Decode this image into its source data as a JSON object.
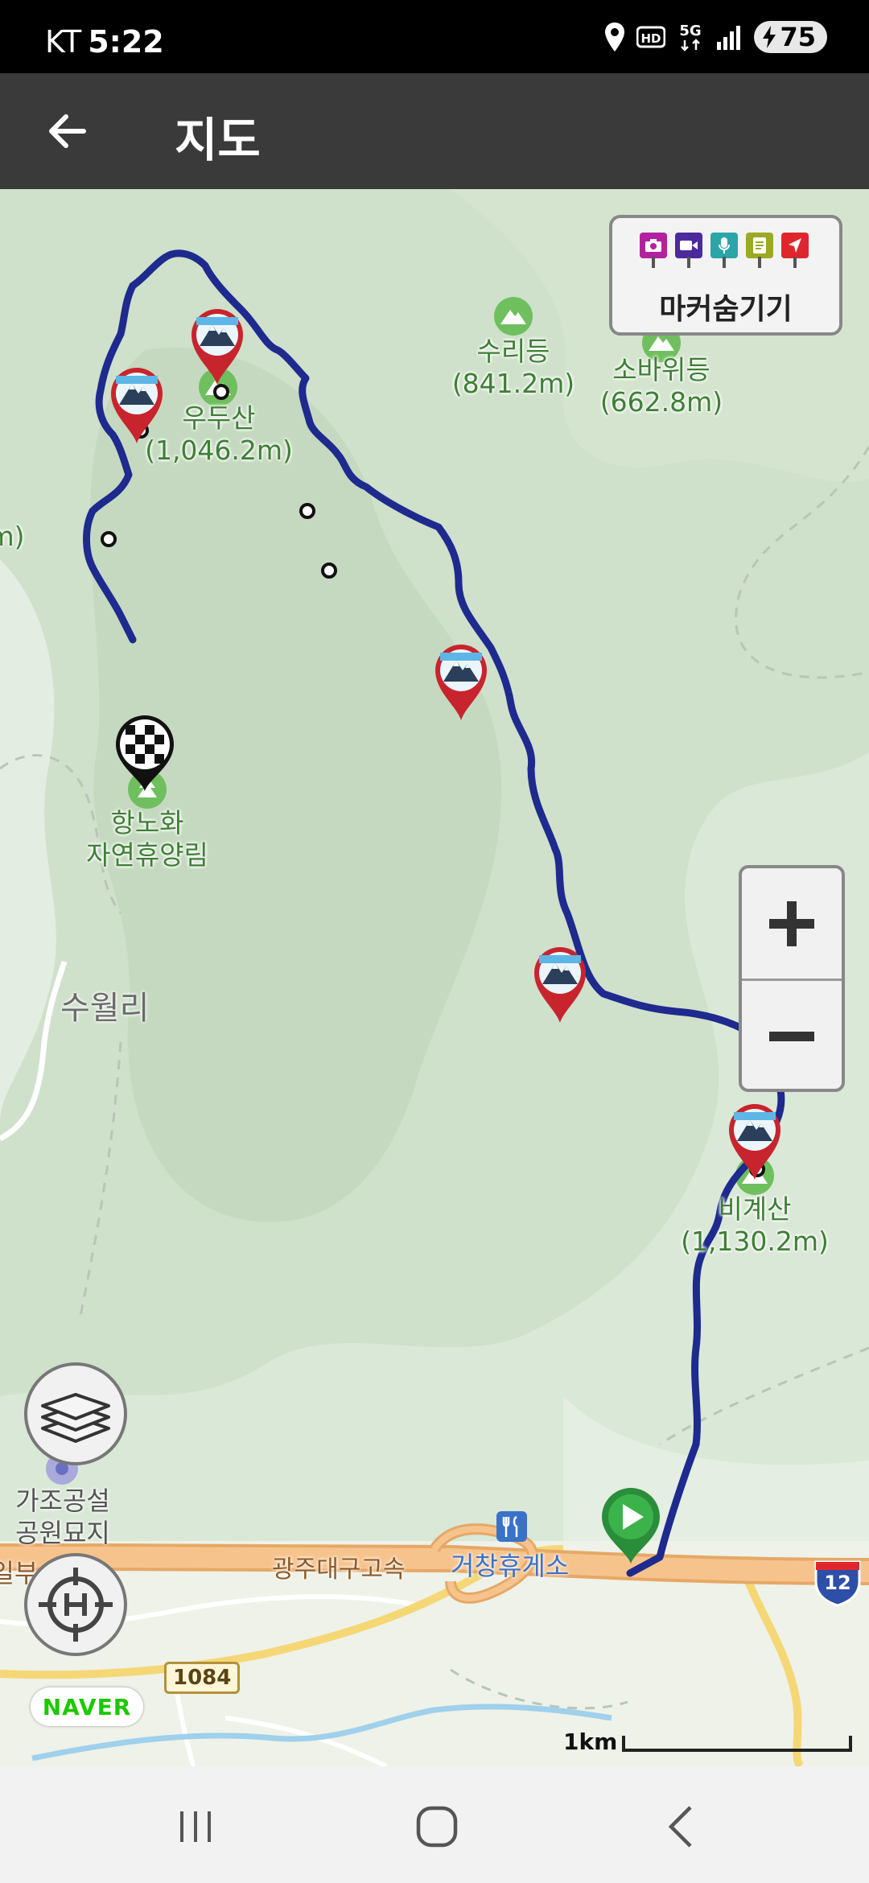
{
  "status_bar": {
    "carrier": "KT",
    "time": "5:22",
    "battery": "75",
    "icons": [
      "location-icon",
      "hd-icon",
      "5g-icon",
      "signal-icon",
      "battery-icon"
    ]
  },
  "app_bar": {
    "title": "지도"
  },
  "map": {
    "marker_toggle_label": "마커숨기기",
    "marker_flag_colors": [
      "#b3229e",
      "#4c2a9e",
      "#2aa5a8",
      "#9caa21",
      "#e0262d"
    ],
    "route_color": "#1e2a8e",
    "pois": [
      {
        "name": "수리등",
        "elevation": "(841.2m)"
      },
      {
        "name": "소바위등",
        "elevation": "(662.8m)"
      },
      {
        "name": "우두산",
        "elevation": "(1,046.2m)"
      },
      {
        "name": "항노화",
        "sub": "자연휴양림"
      },
      {
        "name": "비계산",
        "elevation": "(1,130.2m)"
      }
    ],
    "edge_label": "m)",
    "village": "수월리",
    "cemetery": {
      "line1": "가조공설",
      "line2": "공원묘지"
    },
    "highway_name": "광주대구고속",
    "rest_area": "거창휴게소",
    "highway_number": "12",
    "road_number": "1084",
    "left_edge_label": "일부",
    "naver": "NAVER",
    "scale": "1km"
  }
}
